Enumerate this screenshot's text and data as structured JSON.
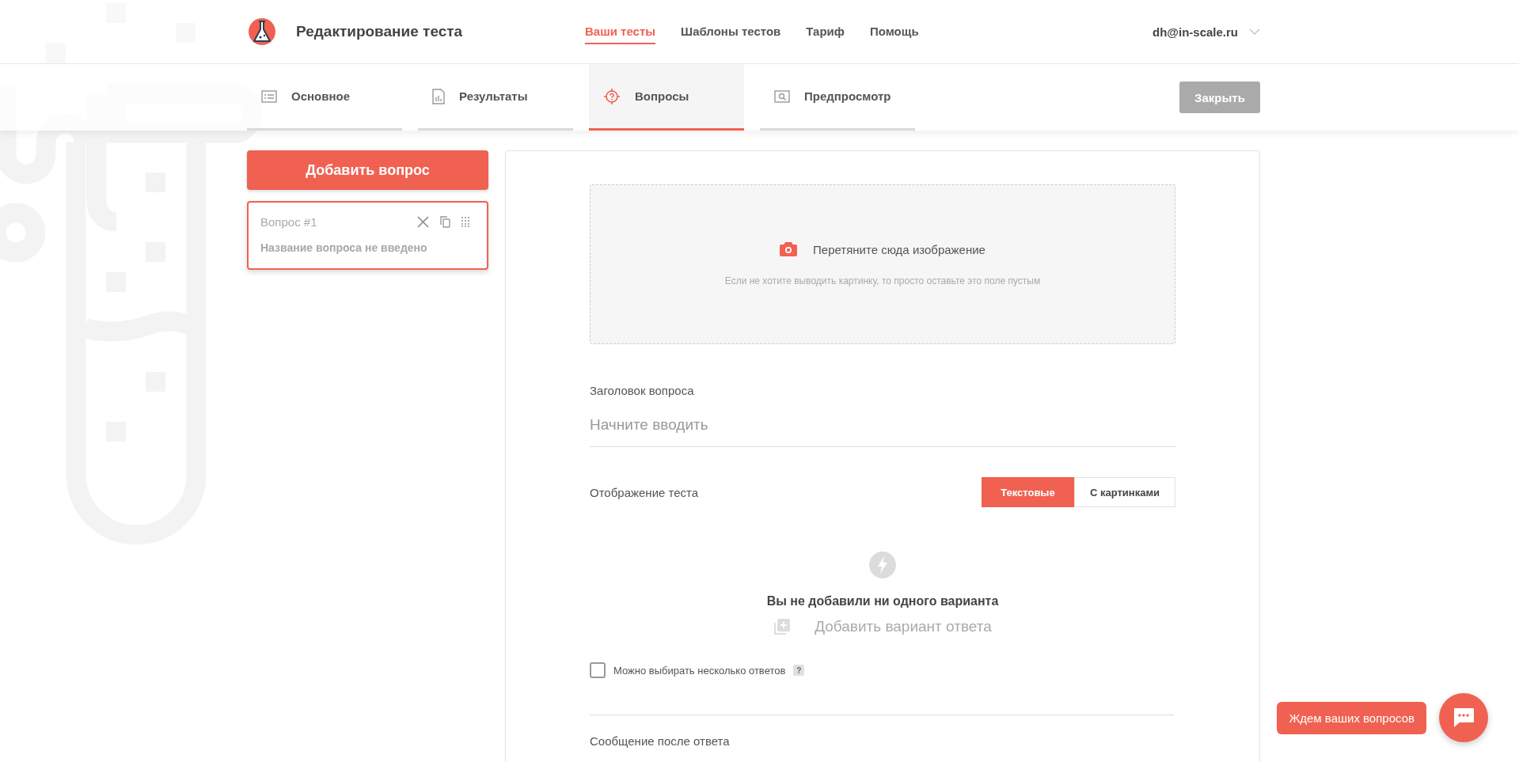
{
  "header": {
    "title": "Редактирование теста",
    "user": "dh@in-scale.ru",
    "nav": [
      {
        "label": "Ваши тесты",
        "selected": true
      },
      {
        "label": "Шаблоны тестов",
        "selected": false
      },
      {
        "label": "Тариф",
        "selected": false
      },
      {
        "label": "Помощь",
        "selected": false
      }
    ]
  },
  "tabs": [
    {
      "label": "Основное",
      "kind": "list",
      "selected": false
    },
    {
      "label": "Результаты",
      "kind": "chart",
      "selected": false
    },
    {
      "label": "Вопросы",
      "kind": "target",
      "selected": true
    },
    {
      "label": "Предпросмотр",
      "kind": "preview",
      "selected": false
    }
  ],
  "close_button": "Закрыть",
  "sidebar": {
    "add_button": "Добавить вопрос",
    "questions": [
      {
        "title": "Вопрос #1",
        "name": "Название вопроса не введено",
        "selected": true
      }
    ]
  },
  "editor": {
    "dropzone": {
      "title": "Перетяните сюда изображение",
      "hint": "Если не хотите выводить картинку, то просто оставьте это поле пустым"
    },
    "question_title": {
      "label": "Заголовок вопроса",
      "placeholder": "Начните вводить"
    },
    "display": {
      "label": "Отображение теста",
      "options": [
        {
          "label": "Текстовые",
          "selected": true
        },
        {
          "label": "С картинками",
          "selected": false
        }
      ]
    },
    "empty": {
      "title": "Вы не добавили ни одного варианта",
      "add_link": "Добавить вариант ответа"
    },
    "multiple": {
      "label": "Можно выбирать несколько ответов",
      "checked": false,
      "help": "?"
    },
    "after_message_label": "Сообщение после ответа"
  },
  "chat": {
    "label": "Ждем ваших вопросов"
  }
}
